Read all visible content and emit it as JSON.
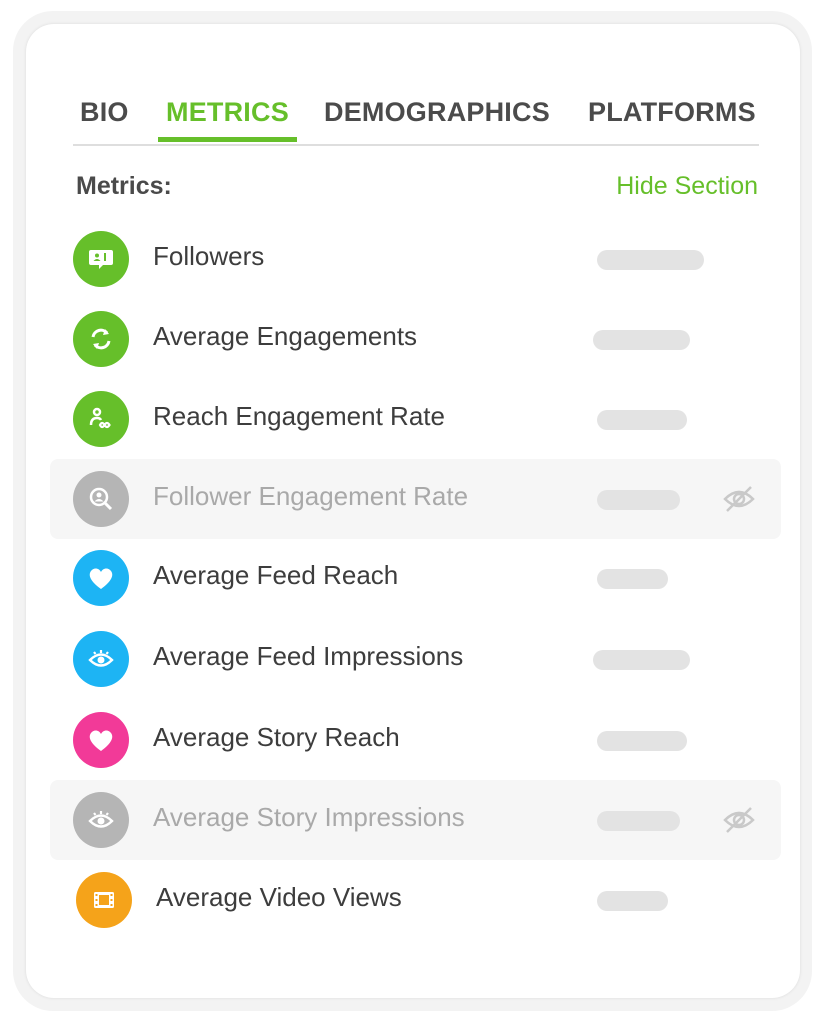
{
  "tabs": [
    {
      "label": "BIO",
      "active": false
    },
    {
      "label": "METRICS",
      "active": true
    },
    {
      "label": "DEMOGRAPHICS",
      "active": false
    },
    {
      "label": "PLATFORMS",
      "active": false
    }
  ],
  "section": {
    "title": "Metrics:",
    "hide_label": "Hide Section"
  },
  "colors": {
    "accent_green": "#66bf2a",
    "blue": "#1db4f4",
    "pink": "#f23a98",
    "orange": "#f5a31a",
    "grey": "#b5b5b5"
  },
  "metrics": [
    {
      "label": "Followers",
      "icon": "chat-bubble-user-icon",
      "color": "#66bf2a",
      "hidden": false
    },
    {
      "label": "Average Engagements",
      "icon": "refresh-icon",
      "color": "#66bf2a",
      "hidden": false
    },
    {
      "label": "Reach Engagement Rate",
      "icon": "person-infinity-icon",
      "color": "#66bf2a",
      "hidden": false
    },
    {
      "label": "Follower Engagement Rate",
      "icon": "user-search-icon",
      "color": "#b5b5b5",
      "hidden": true
    },
    {
      "label": "Average Feed Reach",
      "icon": "heart-icon",
      "color": "#1db4f4",
      "hidden": false
    },
    {
      "label": "Average Feed Impressions",
      "icon": "eye-icon",
      "color": "#1db4f4",
      "hidden": false
    },
    {
      "label": "Average Story Reach",
      "icon": "heart-icon",
      "color": "#f23a98",
      "hidden": false
    },
    {
      "label": "Average Story Impressions",
      "icon": "eye-icon",
      "color": "#b5b5b5",
      "hidden": true
    },
    {
      "label": "Average Video Views",
      "icon": "film-icon",
      "color": "#f5a31a",
      "hidden": false
    }
  ]
}
